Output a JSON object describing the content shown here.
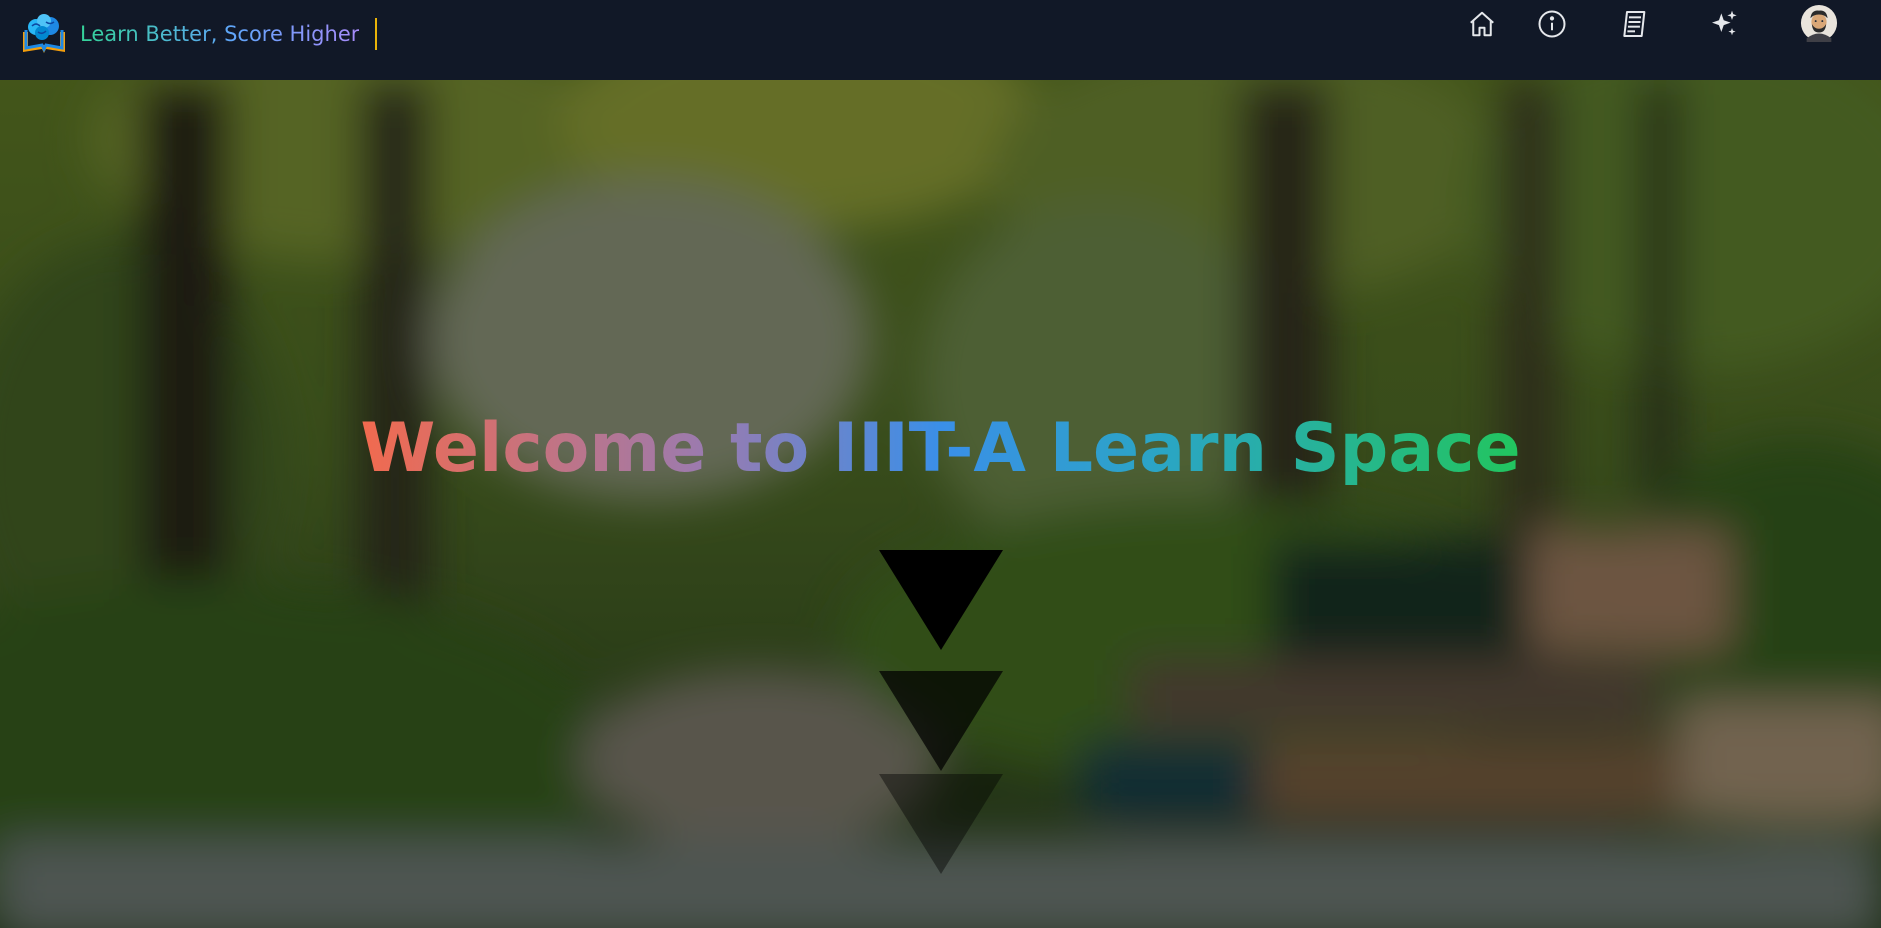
{
  "header": {
    "tagline": "Learn Better, Score Higher",
    "logo_icon": "brain-book-logo-icon",
    "nav_icons": [
      "home-icon",
      "info-icon",
      "notes-icon",
      "sparkles-icon",
      "user-avatar"
    ]
  },
  "hero": {
    "title": "Welcome to IIIT-A Learn Space",
    "scroll_indicator": "scroll-down-arrows-icon"
  },
  "colors": {
    "navbar_bg": "#111827",
    "caret": "#eab308",
    "title_gradient": [
      "#f26a4e",
      "#9a7bb0",
      "#3a8fe8",
      "#2aa6c2",
      "#22c55e"
    ],
    "tagline_gradient": [
      "#34d399",
      "#60a5fa",
      "#a78bfa"
    ]
  }
}
